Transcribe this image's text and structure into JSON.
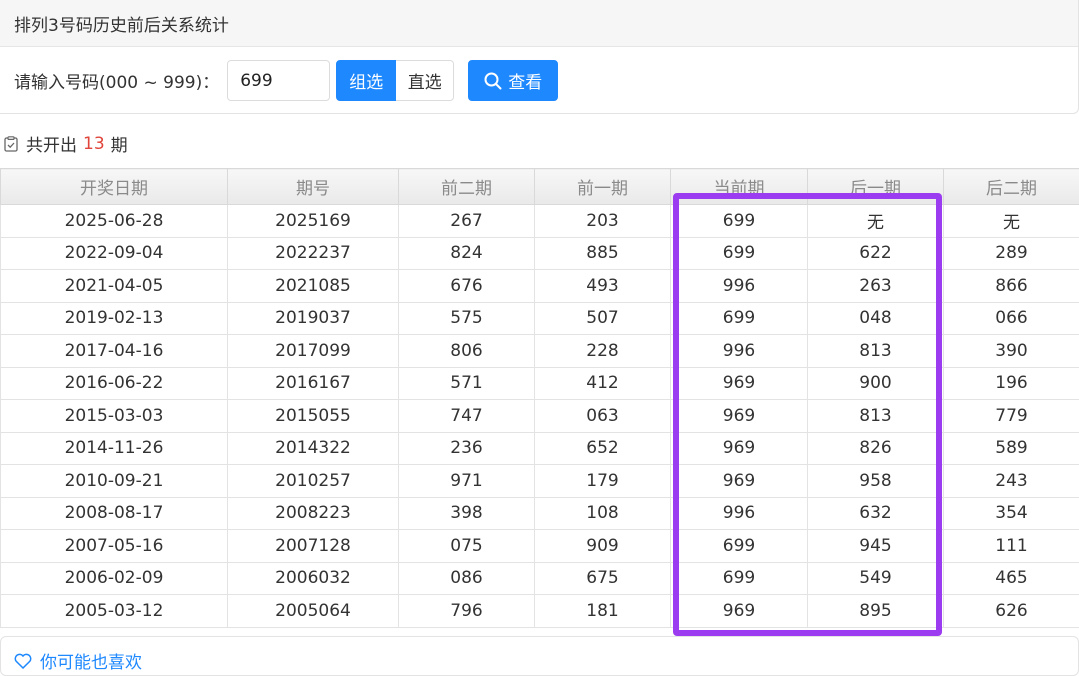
{
  "header": {
    "title": "排列3号码历史前后关系统计"
  },
  "form": {
    "label": "请输入号码(000 ~ 999)：",
    "input_value": "699",
    "btn_group": "组选",
    "btn_direct": "直选",
    "btn_search": "查看"
  },
  "summary": {
    "prefix": "共开出",
    "count": "13",
    "suffix": "期"
  },
  "table": {
    "headers": [
      "开奖日期",
      "期号",
      "前二期",
      "前一期",
      "当前期",
      "后一期",
      "后二期"
    ],
    "rows": [
      [
        "2025-06-28",
        "2025169",
        "267",
        "203",
        "699",
        "无",
        "无"
      ],
      [
        "2022-09-04",
        "2022237",
        "824",
        "885",
        "699",
        "622",
        "289"
      ],
      [
        "2021-04-05",
        "2021085",
        "676",
        "493",
        "996",
        "263",
        "866"
      ],
      [
        "2019-02-13",
        "2019037",
        "575",
        "507",
        "699",
        "048",
        "066"
      ],
      [
        "2017-04-16",
        "2017099",
        "806",
        "228",
        "996",
        "813",
        "390"
      ],
      [
        "2016-06-22",
        "2016167",
        "571",
        "412",
        "969",
        "900",
        "196"
      ],
      [
        "2015-03-03",
        "2015055",
        "747",
        "063",
        "969",
        "813",
        "779"
      ],
      [
        "2014-11-26",
        "2014322",
        "236",
        "652",
        "969",
        "826",
        "589"
      ],
      [
        "2010-09-21",
        "2010257",
        "971",
        "179",
        "969",
        "958",
        "243"
      ],
      [
        "2008-08-17",
        "2008223",
        "398",
        "108",
        "996",
        "632",
        "354"
      ],
      [
        "2007-05-16",
        "2007128",
        "075",
        "909",
        "699",
        "945",
        "111"
      ],
      [
        "2006-02-09",
        "2006032",
        "086",
        "675",
        "699",
        "549",
        "465"
      ],
      [
        "2005-03-12",
        "2005064",
        "796",
        "181",
        "969",
        "895",
        "626"
      ]
    ]
  },
  "footer": {
    "title": "你可能也喜欢"
  },
  "colors": {
    "accent": "#1e88ff",
    "count": "#e0443a",
    "highlight": "#9b3cf0"
  }
}
